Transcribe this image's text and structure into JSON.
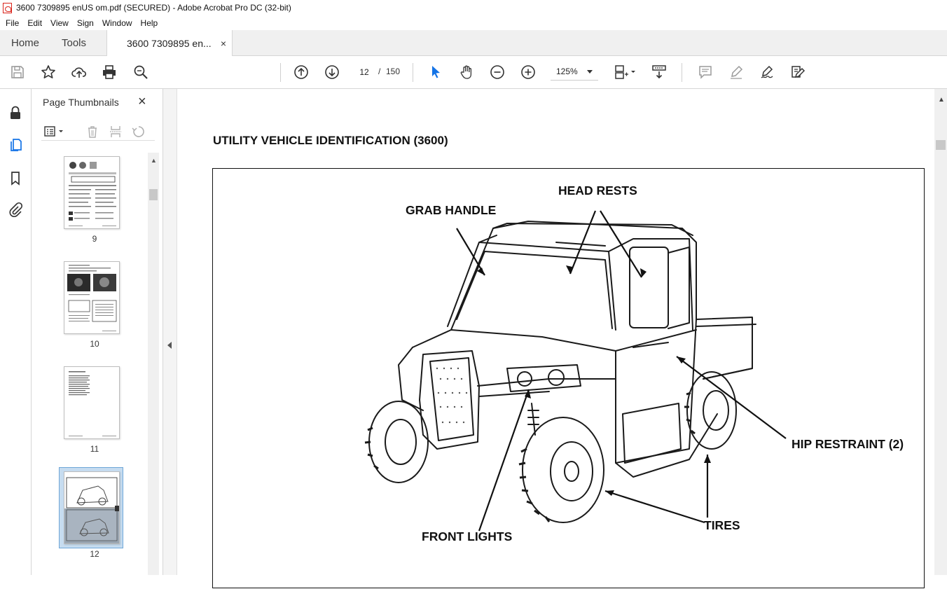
{
  "window": {
    "title": "3600 7309895 enUS om.pdf (SECURED) - Adobe Acrobat Pro DC (32-bit)"
  },
  "menu": [
    "File",
    "Edit",
    "View",
    "Sign",
    "Window",
    "Help"
  ],
  "tabs": {
    "home": "Home",
    "tools": "Tools",
    "document": "3600 7309895 en...",
    "close_glyph": "×"
  },
  "toolbar": {
    "current_page": "12",
    "separator": "/",
    "total_pages": "150",
    "zoom": "125%",
    "icons": [
      "save-icon",
      "bookmark-star-icon",
      "upload-icon",
      "print-icon",
      "search-icon",
      "page-up-icon",
      "page-down-icon",
      "select-arrow-icon",
      "hand-icon",
      "zoom-out-icon",
      "zoom-in-icon",
      "fit-page-icon",
      "scroll-mode-icon",
      "comment-icon",
      "highlight-icon",
      "sign-icon",
      "redact-icon"
    ]
  },
  "left_rail": {
    "icons": [
      "lock-icon",
      "pages-icon",
      "bookmark-icon",
      "attachment-icon"
    ]
  },
  "thumbnail_panel": {
    "title": "Page Thumbnails",
    "close_glyph": "×",
    "pages": [
      {
        "label": "9"
      },
      {
        "label": "10"
      },
      {
        "label": "11"
      },
      {
        "label": "12",
        "selected": true
      }
    ]
  },
  "document": {
    "heading": "UTILITY VEHICLE IDENTIFICATION (3600)",
    "callouts": {
      "head_rests": "HEAD RESTS",
      "grab_handle": "GRAB HANDLE",
      "hip_restraint": "HIP RESTRAINT (2)",
      "front_lights": "FRONT LIGHTS",
      "tires": "TIRES"
    }
  }
}
